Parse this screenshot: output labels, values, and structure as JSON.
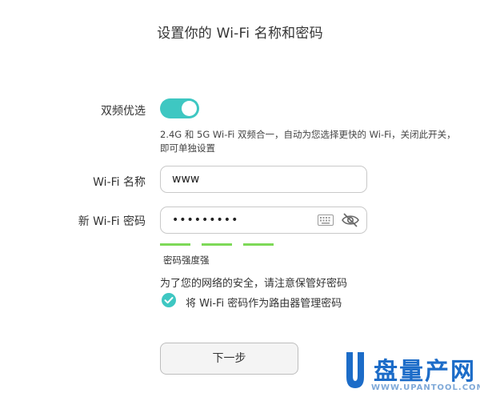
{
  "page": {
    "title": "设置你的 Wi-Fi 名称和密码"
  },
  "dual_band": {
    "label": "双频优选",
    "enabled": true,
    "description": "2.4G 和 5G Wi-Fi 双频合一，自动为您选择更快的 Wi-Fi，关闭此开关，即可单独设置"
  },
  "wifi_name": {
    "label": "Wi-Fi 名称",
    "value": "www"
  },
  "wifi_password": {
    "label": "新 Wi-Fi 密码",
    "value": "•••••••••",
    "keyboard_icon": "keyboard-icon",
    "visibility_icon": "eye-hidden-icon"
  },
  "strength": {
    "label": "密码强度强",
    "color": "#7dd957",
    "level": 3,
    "max": 3
  },
  "security": {
    "notice": "为了您的网络的安全，请注意保管好密码",
    "checkbox_label": "将 Wi-Fi 密码作为路由器管理密码",
    "checked": true
  },
  "actions": {
    "next_label": "下一步"
  },
  "watermark": {
    "text": "盘量产网",
    "url": "WWW.UPANTOOL.COM"
  },
  "colors": {
    "accent": "#3ec7c2"
  }
}
